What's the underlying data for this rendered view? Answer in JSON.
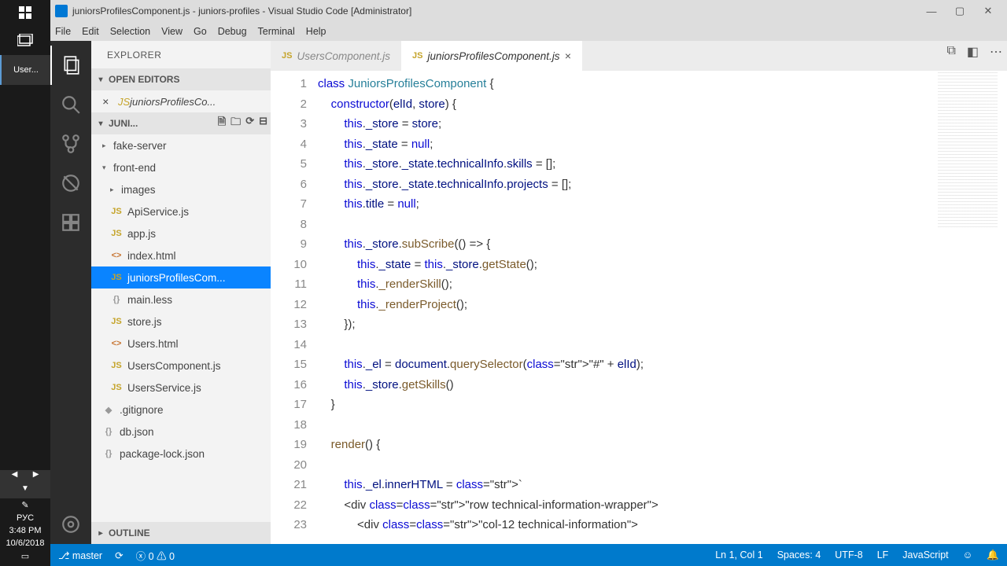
{
  "title": "juniorsProfilesComponent.js - juniors-profiles - Visual Studio Code [Administrator]",
  "menu": [
    "File",
    "Edit",
    "Selection",
    "View",
    "Go",
    "Debug",
    "Terminal",
    "Help"
  ],
  "taskbar": {
    "active_app": "User...",
    "clock": "3:48 PM",
    "date": "10/6/2018",
    "lang": "РУС"
  },
  "explorer": {
    "title": "EXPLORER",
    "open_editors_label": "OPEN EDITORS",
    "open_editors": [
      {
        "name": "juniorsProfilesCo...",
        "icon": "JS"
      }
    ],
    "project_label": "JUNI...",
    "outline_label": "OUTLINE",
    "tree": [
      {
        "type": "folder",
        "name": "fake-server",
        "level": 0,
        "expanded": false
      },
      {
        "type": "folder",
        "name": "front-end",
        "level": 0,
        "expanded": true
      },
      {
        "type": "folder",
        "name": "images",
        "level": 1,
        "expanded": false
      },
      {
        "type": "file",
        "name": "ApiService.js",
        "icon": "JS",
        "level": 1
      },
      {
        "type": "file",
        "name": "app.js",
        "icon": "JS",
        "level": 1
      },
      {
        "type": "file",
        "name": "index.html",
        "icon": "<>",
        "level": 1
      },
      {
        "type": "file",
        "name": "juniorsProfilesCom...",
        "icon": "JS",
        "level": 1,
        "selected": true
      },
      {
        "type": "file",
        "name": "main.less",
        "icon": "{}",
        "level": 1
      },
      {
        "type": "file",
        "name": "store.js",
        "icon": "JS",
        "level": 1
      },
      {
        "type": "file",
        "name": "Users.html",
        "icon": "<>",
        "level": 1
      },
      {
        "type": "file",
        "name": "UsersComponent.js",
        "icon": "JS",
        "level": 1
      },
      {
        "type": "file",
        "name": "UsersService.js",
        "icon": "JS",
        "level": 1
      },
      {
        "type": "file",
        "name": ".gitignore",
        "icon": "◆",
        "level": 0
      },
      {
        "type": "file",
        "name": "db.json",
        "icon": "{}",
        "level": 0
      },
      {
        "type": "file",
        "name": "package-lock.json",
        "icon": "{}",
        "level": 0
      }
    ]
  },
  "tabs": [
    {
      "label": "UsersComponent.js",
      "active": false
    },
    {
      "label": "juniorsProfilesComponent.js",
      "active": true
    }
  ],
  "code_lines": [
    "class JuniorsProfilesComponent {",
    "    constructor(elId, store) {",
    "        this._store = store;",
    "        this._state = null;",
    "        this._store._state.technicalInfo.skills = [];",
    "        this._store._state.technicalInfo.projects = [];",
    "        this.title = null;",
    "",
    "        this._store.subScribe(() => {",
    "            this._state = this._store.getState();",
    "            this._renderSkill();",
    "            this._renderProject();",
    "        });",
    "",
    "        this._el = document.querySelector(\"#\" + elId);",
    "        this._store.getSkills()",
    "    }",
    "",
    "    render() {",
    "",
    "        this._el.innerHTML = `",
    "        <div class=\"row technical-information-wrapper\">",
    "            <div class=\"col-12 technical-information\">"
  ],
  "statusbar": {
    "branch": "master",
    "errors": "0",
    "warnings": "0",
    "position": "Ln 1, Col 1",
    "spaces": "Spaces: 4",
    "encoding": "UTF-8",
    "eol": "LF",
    "language": "JavaScript"
  }
}
